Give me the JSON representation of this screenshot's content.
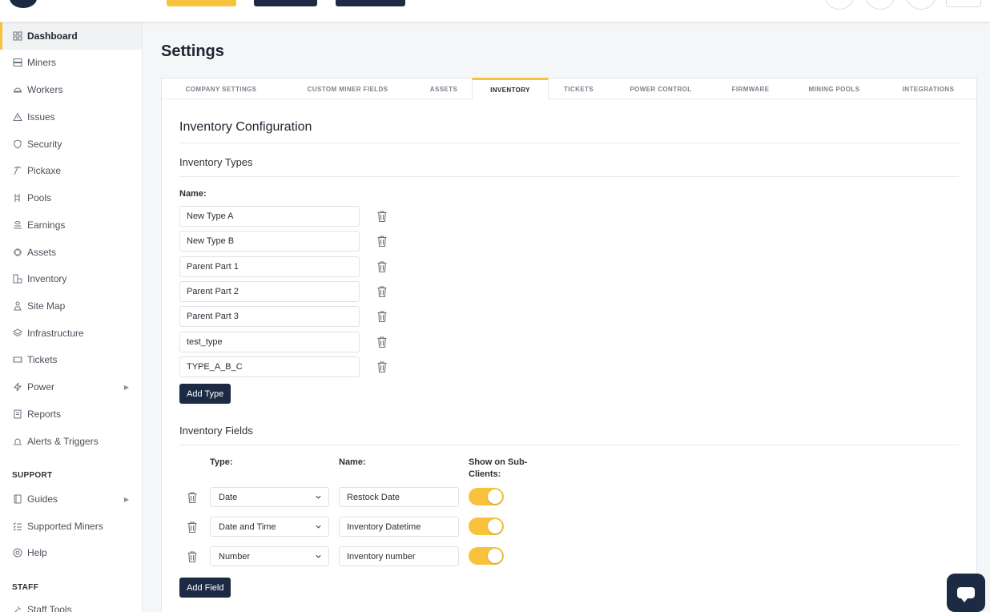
{
  "sidebar": {
    "items": [
      {
        "label": "Dashboard",
        "icon": "grid-icon",
        "active": true
      },
      {
        "label": "Miners",
        "icon": "server-icon"
      },
      {
        "label": "Workers",
        "icon": "helmet-icon"
      },
      {
        "label": "Issues",
        "icon": "warning-icon"
      },
      {
        "label": "Security",
        "icon": "shield-icon"
      },
      {
        "label": "Pickaxe",
        "icon": "pickaxe-icon"
      },
      {
        "label": "Pools",
        "icon": "pools-icon"
      },
      {
        "label": "Earnings",
        "icon": "coins-icon"
      },
      {
        "label": "Assets",
        "icon": "chip-icon"
      },
      {
        "label": "Inventory",
        "icon": "boxes-icon"
      },
      {
        "label": "Site Map",
        "icon": "sitemap-icon"
      },
      {
        "label": "Infrastructure",
        "icon": "layers-icon"
      },
      {
        "label": "Tickets",
        "icon": "ticket-icon"
      },
      {
        "label": "Power",
        "icon": "bolt-icon",
        "has_submenu": true
      },
      {
        "label": "Reports",
        "icon": "report-icon"
      },
      {
        "label": "Alerts & Triggers",
        "icon": "alert-icon"
      }
    ],
    "support_heading": "SUPPORT",
    "support_items": [
      {
        "label": "Guides",
        "icon": "book-icon",
        "has_submenu": true
      },
      {
        "label": "Supported Miners",
        "icon": "checklist-icon"
      },
      {
        "label": "Help",
        "icon": "lifebuoy-icon"
      }
    ],
    "staff_heading": "STAFF",
    "staff_items": [
      {
        "label": "Staff Tools",
        "icon": "tools-icon"
      }
    ]
  },
  "page": {
    "title": "Settings"
  },
  "tabs": [
    {
      "label": "COMPANY SETTINGS"
    },
    {
      "label": "CUSTOM MINER FIELDS"
    },
    {
      "label": "ASSETS"
    },
    {
      "label": "INVENTORY",
      "active": true
    },
    {
      "label": "TICKETS"
    },
    {
      "label": "POWER CONTROL"
    },
    {
      "label": "FIRMWARE"
    },
    {
      "label": "MINING POOLS"
    },
    {
      "label": "INTEGRATIONS"
    }
  ],
  "inventory": {
    "heading": "Inventory Configuration",
    "types_heading": "Inventory Types",
    "name_label": "Name:",
    "types": [
      "New Type A",
      "New Type B",
      "Parent Part 1",
      "Parent Part 2",
      "Parent Part 3",
      "test_type",
      "TYPE_A_B_C"
    ],
    "add_type_label": "Add Type",
    "fields_heading": "Inventory Fields",
    "col_type": "Type:",
    "col_name": "Name:",
    "col_show": "Show on Sub-Clients:",
    "fields": [
      {
        "type": "Date",
        "name": "Restock Date",
        "show": true
      },
      {
        "type": "Date and Time",
        "name": "Inventory Datetime",
        "show": true
      },
      {
        "type": "Number",
        "name": "Inventory number",
        "show": true
      }
    ],
    "add_field_label": "Add Field"
  },
  "colors": {
    "accent": "#f9c23c",
    "navy": "#1c2a44"
  }
}
